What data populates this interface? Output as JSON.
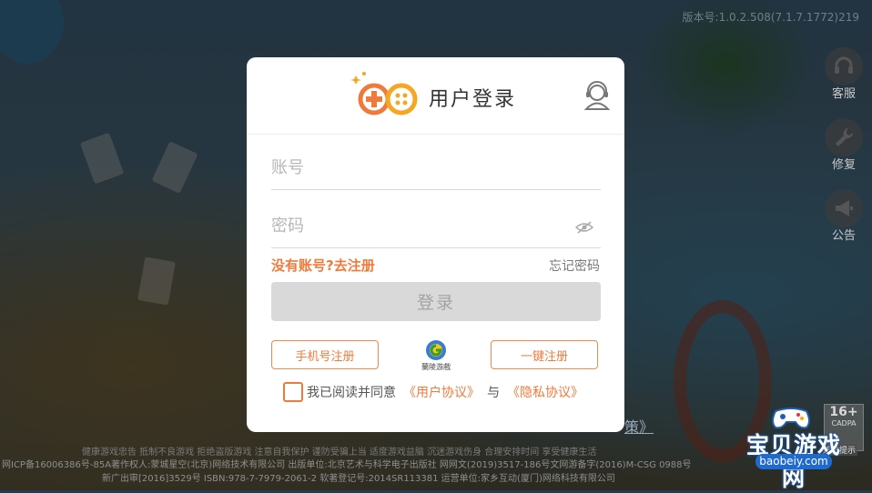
{
  "version": "版本号:1.0.2.508(7.1.7.1772)219",
  "side_buttons": [
    {
      "label": "客服",
      "icon": "headset-icon"
    },
    {
      "label": "修复",
      "icon": "wrench-icon"
    },
    {
      "label": "公告",
      "icon": "megaphone-icon"
    }
  ],
  "dialog": {
    "title": "用户登录",
    "account_placeholder": "账号",
    "password_placeholder": "密码",
    "register_link": "没有账号?去注册",
    "forgot_password": "忘记密码",
    "login_button": "登录",
    "phone_register": "手机号注册",
    "quick_register": "一键注册",
    "mid_logo_caption": "蘭陵游戲",
    "agree_text": "我已阅读并同意",
    "user_agreement": "《用户协议》",
    "and_text": "与",
    "privacy_agreement": "《隐私协议》"
  },
  "age_rating": {
    "main": "16+",
    "sub": "CADPA",
    "tip": "适龄提示"
  },
  "policy_peek": "策》",
  "footer": {
    "line1": "健康游戏忠告 抵制不良游戏 拒绝盗版游戏 注意自我保护 谨防受骗上当 适度游戏益脑 沉迷游戏伤身 合理安排时间 享受健康生活",
    "line2": "网ICP备16006386号-85A著作权人:蒙城星空(北京)网络技术有限公司 出版单位:北京艺术与科学电子出版社 网网文(2019)3517-186号文网游备字(2016)M-CSG 0988号",
    "line3": "新广出审[2016]3529号 ISBN:978-7-7979-2061-2 软著登记号:2014SR113381 运营单位:家乡互动(厦门)网络科技有限公司"
  },
  "watermark": {
    "text": "宝贝游戏网",
    "url": "baobeiy.com"
  },
  "colors": {
    "accent": "#f07a3c",
    "login_disabled_bg": "#d9d9d9",
    "dialog_bg": "#ffffff"
  }
}
